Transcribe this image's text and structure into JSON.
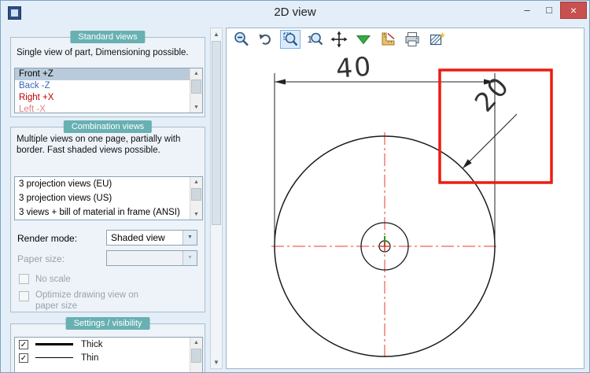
{
  "window": {
    "title": "2D view",
    "minimize_glyph": "–",
    "maximize_glyph": "□",
    "close_glyph": "×"
  },
  "icons": {
    "scroll_up": "▲",
    "scroll_down": "▼",
    "dropdown": "▼"
  },
  "sidebar": {
    "standard_views": {
      "header": "Standard views",
      "description": "Single view of part, Dimensioning possible.",
      "items": [
        {
          "label": "Front +Z",
          "style": "color:#000000;background:#b9cadb",
          "selected": true
        },
        {
          "label": "Back -Z",
          "style": "color:#3a67b8",
          "selected": false
        },
        {
          "label": "Right +X",
          "style": "color:#c00000",
          "selected": false
        },
        {
          "label": "Left -X",
          "style": "color:#dd8282",
          "selected": false
        }
      ]
    },
    "combination_views": {
      "header": "Combination views",
      "description": "Multiple views on one page, partially with border. Fast shaded views possible.",
      "items": [
        {
          "label": "3 projection views (EU)"
        },
        {
          "label": "3 projection views (US)"
        },
        {
          "label": "3 views + bill of material in frame (ANSI)"
        }
      ],
      "render_mode": {
        "label": "Render mode:",
        "value": "Shaded view"
      },
      "paper_size": {
        "label": "Paper size:",
        "value": ""
      },
      "no_scale": {
        "label": "No scale",
        "checked": false
      },
      "optimize": {
        "label": "Optimize drawing view on paper size",
        "checked": false
      }
    },
    "settings_visibility": {
      "header": "Settings / visibility",
      "items": [
        {
          "label": "Thick",
          "checked": true,
          "check_glyph": "✓",
          "line": "thick"
        },
        {
          "label": "Thin",
          "checked": true,
          "check_glyph": "✓",
          "line": "thin"
        }
      ]
    }
  },
  "toolbar": {
    "zoom_one_glyph": "1",
    "icons": [
      "zoom-out",
      "undo",
      "zoom-window",
      "zoom-one",
      "pan",
      "mesh-down-arrow",
      "dimension-ruler",
      "print",
      "hatch-settings"
    ],
    "active_tool": "zoom-window"
  },
  "drawing": {
    "dim_outer_diameter": "40",
    "dim_radius": "20"
  },
  "colors": {
    "badge_teal": "#68b0b2",
    "selection": "#b9cadb",
    "highlight_red": "#ec1c10",
    "centerline_red": "#ea3b2a",
    "green_arrow": "#35ac3f",
    "close_button": "#c85050"
  }
}
